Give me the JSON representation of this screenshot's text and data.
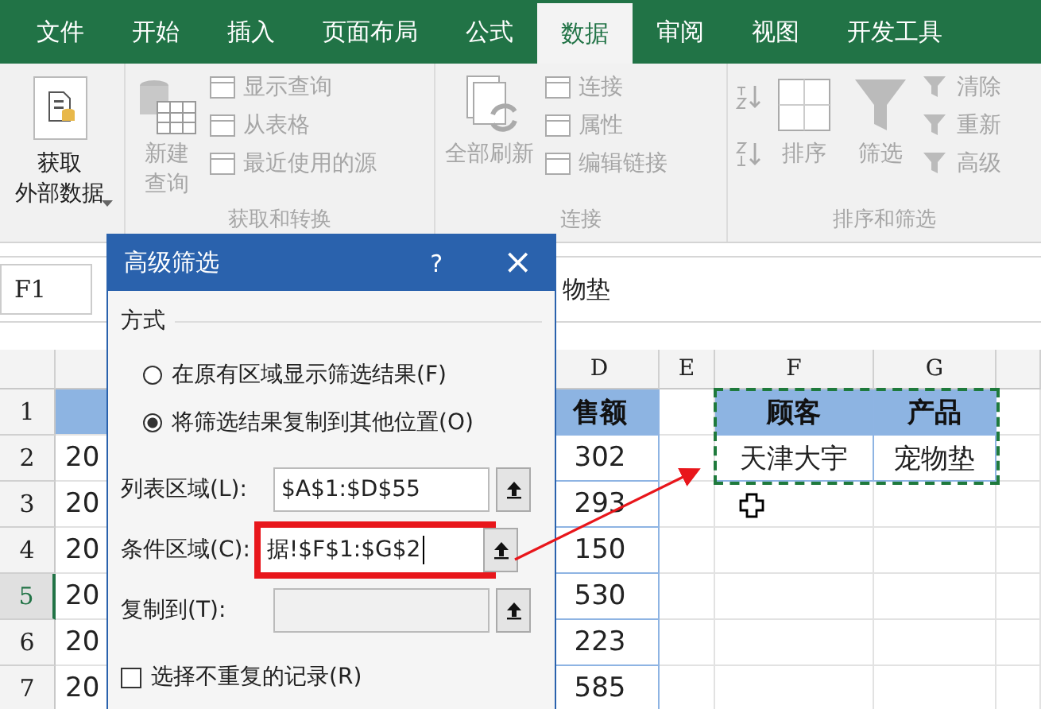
{
  "tabs": [
    {
      "label": "文件",
      "selected": false
    },
    {
      "label": "开始",
      "selected": false
    },
    {
      "label": "插入",
      "selected": false
    },
    {
      "label": "页面布局",
      "selected": false
    },
    {
      "label": "公式",
      "selected": false
    },
    {
      "label": "数据",
      "selected": true
    },
    {
      "label": "审阅",
      "selected": false
    },
    {
      "label": "视图",
      "selected": false
    },
    {
      "label": "开发工具",
      "selected": false
    }
  ],
  "ribbon": {
    "get_external": {
      "lines": [
        "获取",
        "外部数据"
      ],
      "disabled": false
    },
    "groups": [
      {
        "label": "获取和转换",
        "large": {
          "lines": [
            "新建",
            "查询"
          ],
          "disabled": true
        },
        "small": [
          {
            "label": "显示查询",
            "disabled": true
          },
          {
            "label": "从表格",
            "disabled": true
          },
          {
            "label": "最近使用的源",
            "disabled": true
          }
        ]
      },
      {
        "label": "连接",
        "large": {
          "lines": [
            "全部刷新"
          ],
          "disabled": true
        },
        "small": [
          {
            "label": "连接",
            "disabled": true
          },
          {
            "label": "属性",
            "disabled": true
          },
          {
            "label": "编辑链接",
            "disabled": true
          }
        ]
      },
      {
        "label": "排序和筛选",
        "sort": [
          {
            "label": "排序",
            "disabled": true
          },
          {
            "label": "筛选",
            "disabled": true
          }
        ],
        "small": [
          {
            "label": "清除",
            "disabled": true
          },
          {
            "label": "重新",
            "disabled": true
          },
          {
            "label": "高级",
            "disabled": true
          }
        ]
      }
    ]
  },
  "formula_bar": {
    "name_box": "F1",
    "value": "物垫"
  },
  "sheet": {
    "columns": [
      "D",
      "E",
      "F",
      "G"
    ],
    "rows": [
      {
        "num": "1",
        "selected": false,
        "d": "售额",
        "f": "顾客",
        "g": "产品",
        "header": true
      },
      {
        "num": "2",
        "selected": false,
        "a": "20",
        "d": "302",
        "f": "天津大宇",
        "g": "宠物垫",
        "header": false
      },
      {
        "num": "3",
        "selected": false,
        "a": "20",
        "d": "293",
        "header": false
      },
      {
        "num": "4",
        "selected": false,
        "a": "20",
        "d": "150",
        "header": false
      },
      {
        "num": "5",
        "selected": true,
        "a": "20",
        "d": "530",
        "header": false
      },
      {
        "num": "6",
        "selected": false,
        "a": "20",
        "d": "223",
        "header": false
      },
      {
        "num": "7",
        "selected": false,
        "a": "20",
        "d": "585",
        "header": false
      }
    ]
  },
  "dialog": {
    "title": "高级筛选",
    "help": "?",
    "close": "×",
    "section": "方式",
    "options": [
      {
        "label": "在原有区域显示筛选结果(F)",
        "selected": false
      },
      {
        "label": "将筛选结果复制到其他位置(O)",
        "selected": true
      }
    ],
    "fields": [
      {
        "label": "列表区域(L):",
        "value": "$A$1:$D$55",
        "disabled": false,
        "highlighted": false
      },
      {
        "label": "条件区域(C):",
        "value": "据!$F$1:$G$2",
        "disabled": false,
        "highlighted": true
      },
      {
        "label": "复制到(T):",
        "disabled": true,
        "highlighted": false
      }
    ],
    "unique": {
      "label": "选择不重复的记录(R)",
      "checked": false
    }
  }
}
